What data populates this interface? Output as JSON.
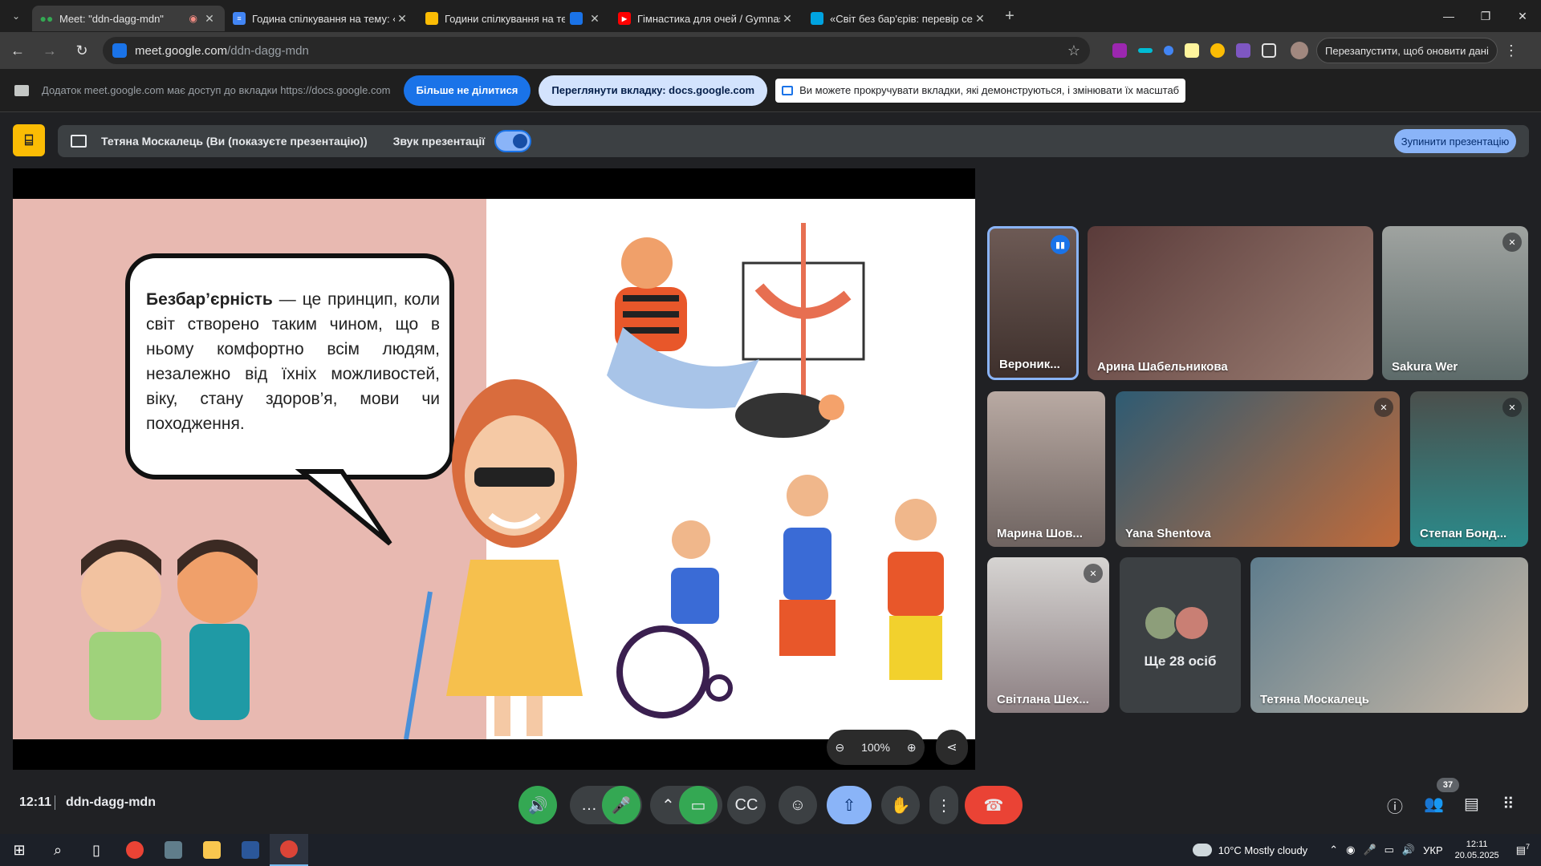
{
  "browser": {
    "tabs": [
      {
        "title": "Meet: \"ddn-dagg-mdn\"",
        "favicon": "meet-icon",
        "color": "#34a853",
        "recording": true,
        "active": true
      },
      {
        "title": "Година спілкування на тему: «",
        "favicon": "docs-icon",
        "color": "#4285f4"
      },
      {
        "title": "Години спілкування на тем",
        "favicon": "slides-icon",
        "color": "#fbbc04",
        "sharing": true
      },
      {
        "title": "Гімнастика для очей / Gymnas",
        "favicon": "youtube-icon",
        "color": "#ff0000"
      },
      {
        "title": "«Світ без бар'єрів: перевір себ",
        "favicon": "wordwall-icon",
        "color": "#00a3e0"
      }
    ],
    "url_host": "meet.google.com",
    "url_path": "/ddn-dagg-mdn",
    "relaunch_label": "Перезапустити, щоб оновити дані"
  },
  "sharebar": {
    "notice": "Додаток meet.google.com має доступ до вкладки https://docs.google.com",
    "stop_sharing": "Більше не ділитися",
    "view_tab": "Переглянути вкладку: docs.google.com",
    "hint": "Ви можете прокручувати вкладки, які демонструються, і змінювати їх масштаб"
  },
  "presentation": {
    "presenter": "Тетяна Москалець (Ви (показуєте презентацію))",
    "audio_label": "Звук презентації",
    "audio_on": true,
    "stop_label": "Зупинити презентацію"
  },
  "slide": {
    "term": "Безбар’єрність",
    "definition": " — це принцип, коли світ створено таким чином, що в ньому комфортно всім людям, незалежно від їхніх можливостей, віку, стану здоров’я, мови чи походження.",
    "zoom": "100%"
  },
  "participants": [
    {
      "name": "Вероник...",
      "speaking": true,
      "muted": false
    },
    {
      "name": "Арина Шабельникова",
      "muted": false
    },
    {
      "name": "Sakura Wer",
      "muted": true
    },
    {
      "name": "Марина Шов...",
      "muted": false
    },
    {
      "name": "Yana Shentova",
      "muted": true
    },
    {
      "name": "Степан Бонд...",
      "muted": true
    },
    {
      "name": "Світлана Шех...",
      "muted": true
    },
    {
      "more_label": "Ще 28 осіб"
    },
    {
      "name": "Тетяна Москалець",
      "muted": false
    }
  ],
  "meeting": {
    "time": "12:11",
    "code": "ddn-dagg-mdn",
    "people_count": "37"
  },
  "taskbar": {
    "weather": "10°C  Mostly cloudy",
    "lang": "УКР",
    "time": "12:11",
    "date": "20.05.2025",
    "notifications": "7"
  }
}
